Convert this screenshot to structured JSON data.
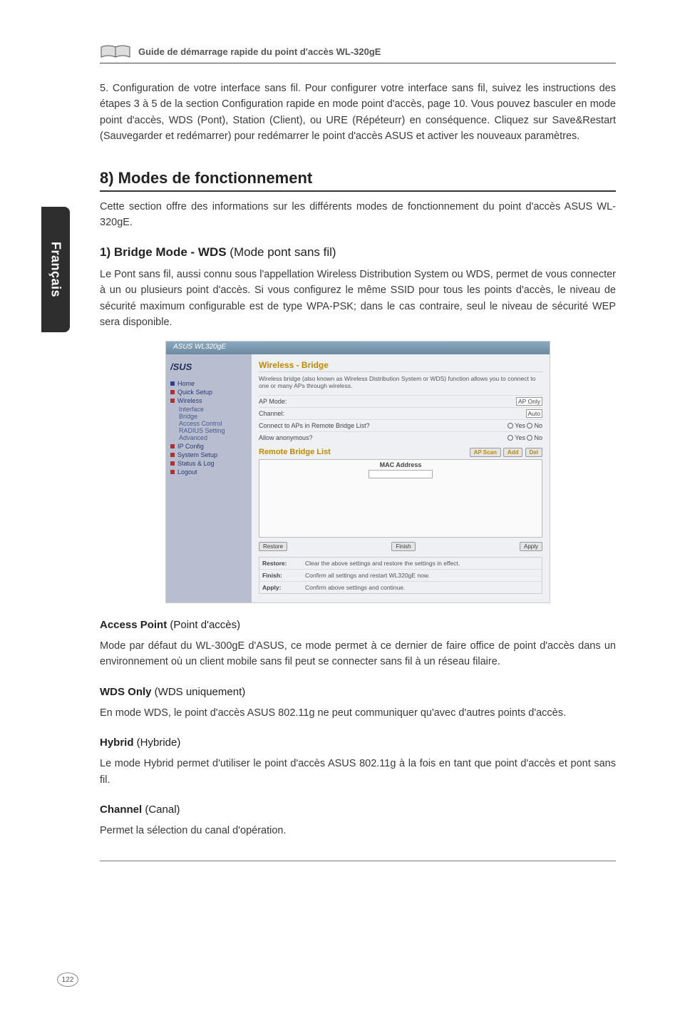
{
  "header": {
    "guide_title": "Guide de démarrage rapide du point d'accès WL-320gE"
  },
  "side_tab": "Français",
  "page_number": "122",
  "para5": "5. Configuration de votre interface sans fil. Pour configurer votre interface sans fil, suivez les instructions des étapes 3 à 5 de la section Configuration rapide en mode point d'accès, page 10. Vous pouvez basculer en mode point d'accès, WDS (Pont), Station (Client), ou URE (Répéteurr) en conséquence. Cliquez sur Save&Restart (Sauvegarder et redémarrer) pour redémarrer le point d'accès ASUS et activer les nouveaux paramètres.",
  "section8": {
    "title": "8) Modes de fonctionnement",
    "intro": "Cette section offre des informations sur les différents modes de fonctionnement du point d'accès ASUS WL-320gE."
  },
  "bridge": {
    "title_bold": "1) Bridge Mode - WDS",
    "title_rest": " (Mode pont sans fil)",
    "para": "Le Pont sans fil, aussi connu sous l'appellation Wireless Distribution System ou WDS, permet de vous connecter à un ou plusieurs point d'accès. Si vous configurez le même SSID pour tous les points d'accès, le niveau de sécurité maximum configurable est de type WPA-PSK; dans le cas contraire, seul le niveau de sécurité WEP sera disponible."
  },
  "screenshot": {
    "top_title": "ASUS WL320gE",
    "logo": "/SUS",
    "side_items": [
      {
        "label": "Home",
        "dot": "blue"
      },
      {
        "label": "Quick Setup",
        "dot": "red"
      },
      {
        "label": "Wireless",
        "dot": "red"
      },
      {
        "label": "Interface",
        "sub": true
      },
      {
        "label": "Bridge",
        "sub": true
      },
      {
        "label": "Access Control",
        "sub": true
      },
      {
        "label": "RADIUS Setting",
        "sub": true
      },
      {
        "label": "Advanced",
        "sub": true
      },
      {
        "label": "IP Config",
        "dot": "red"
      },
      {
        "label": "System Setup",
        "dot": "red"
      },
      {
        "label": "Status & Log",
        "dot": "red"
      },
      {
        "label": "Logout",
        "dot": "red"
      }
    ],
    "main_heading": "Wireless - Bridge",
    "main_desc": "Wireless bridge (also known as Wireless Distribution System or WDS) function allows you to connect to one or many APs through wireless.",
    "rows": {
      "ap_mode_label": "AP Mode:",
      "ap_mode_value": "AP Only",
      "channel_label": "Channel:",
      "channel_value": "Auto",
      "connect_label": "Connect to APs in Remote Bridge List?",
      "connect_yes": "Yes",
      "connect_no": "No",
      "allow_label": "Allow anonymous?",
      "allow_yes": "Yes",
      "allow_no": "No"
    },
    "remote_heading": "Remote Bridge List",
    "btn_scan": "AP Scan",
    "btn_add": "Add",
    "btn_del": "Del",
    "mac_label": "MAC Address",
    "btn_restore": "Restore",
    "btn_finish": "Finish",
    "btn_apply": "Apply",
    "table2": {
      "restore_label": "Restore:",
      "restore_text": "Clear the above settings and restore the settings in effect.",
      "finish_label": "Finish:",
      "finish_text": "Confirm all settings and restart WL320gE now.",
      "apply_label": "Apply:",
      "apply_text": "Confirm above settings and continue."
    }
  },
  "ap": {
    "title_bold": "Access Point",
    "title_rest": " (Point d'accès)",
    "para": "Mode par défaut du WL-300gE d'ASUS, ce mode permet à ce dernier de faire office de point d'accès dans un environnement où un client mobile sans fil peut se connecter sans fil à un réseau filaire."
  },
  "wds": {
    "title_bold": "WDS Only",
    "title_rest": " (WDS uniquement)",
    "para": "En mode WDS, le point d'accès ASUS 802.11g ne peut communiquer qu'avec d'autres points d'accès."
  },
  "hybrid": {
    "title_bold": "Hybrid",
    "title_rest": " (Hybride)",
    "para": "Le mode Hybrid permet d'utiliser le point d'accès ASUS 802.11g à la fois en tant que point d'accès et pont sans fil."
  },
  "channel": {
    "title_bold": "Channel",
    "title_rest": " (Canal)",
    "para": "Permet la sélection du canal d'opération."
  }
}
